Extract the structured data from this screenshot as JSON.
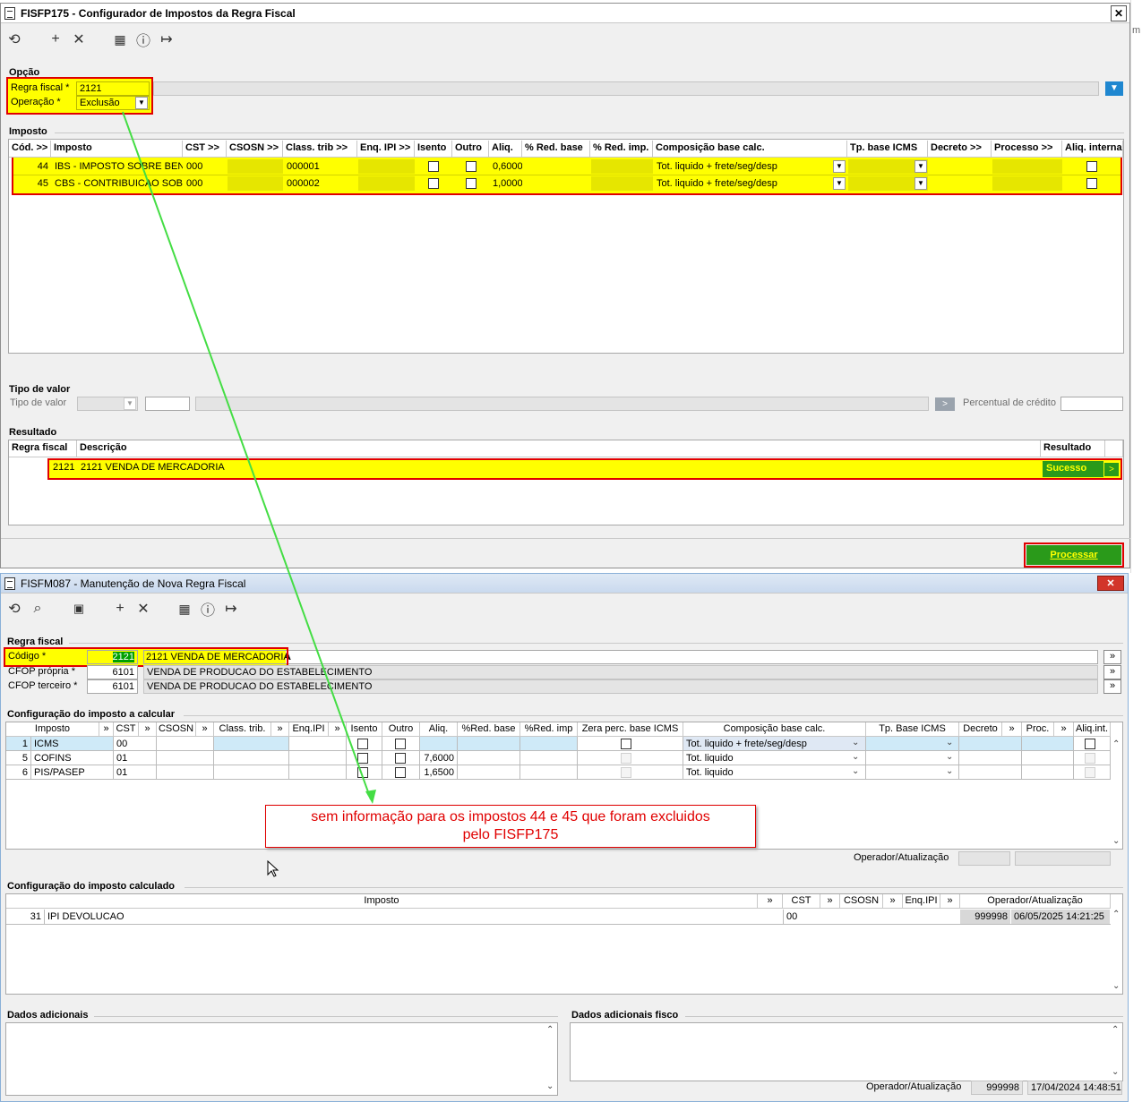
{
  "win1": {
    "title": "FISFP175 - Configurador de Impostos da Regra Fiscal",
    "close": "✕",
    "opcao": {
      "title": "Opção",
      "regra_label": "Regra fiscal *",
      "regra_value": "2121",
      "operacao_label": "Operação *",
      "operacao_value": "Exclusão"
    },
    "imposto": {
      "title": "Imposto",
      "headers": [
        "Cód. >>",
        "Imposto",
        "CST >>",
        "CSOSN >>",
        "Class. trib >>",
        "Enq. IPI >>",
        "Isento",
        "Outro",
        "Aliq.",
        "% Red. base",
        "% Red. imp.",
        "Composição base calc.",
        "Tp. base ICMS",
        "Decreto >>",
        "Processo  >>",
        "Aliq. interna"
      ],
      "rows": [
        {
          "cod": "44",
          "imposto": "IBS - IMPOSTO SOBRE BENS",
          "cst": "000",
          "class": "000001",
          "aliq": "0,6000",
          "comp": "Tot. liquido + frete/seg/desp"
        },
        {
          "cod": "45",
          "imposto": "CBS - CONTRIBUICAO SOBRI",
          "cst": "000",
          "class": "000002",
          "aliq": "1,0000",
          "comp": "Tot. liquido + frete/seg/desp"
        }
      ]
    },
    "tipo": {
      "title": "Tipo de valor",
      "label": "Tipo de valor",
      "perc_label": "Percentual de crédito"
    },
    "resultado": {
      "title": "Resultado",
      "headers": [
        "Regra fiscal",
        "Descrição",
        "Resultado"
      ],
      "row": {
        "regra": "2121",
        "descricao": "2121 VENDA DE MERCADORIA",
        "resultado": "Sucesso",
        "btn": ">"
      }
    },
    "processar": "Processar"
  },
  "win2": {
    "title": "FISFM087 - Manutenção de Nova Regra Fiscal",
    "close": "✕",
    "regra": {
      "title": "Regra fiscal",
      "codigo_label": "Código *",
      "codigo_value": "2121",
      "codigo_desc": "2121 VENDA DE MERCADORIA",
      "cfop_propria_label": "CFOP própria *",
      "cfop_propria_value": "6101",
      "cfop_propria_desc": "VENDA DE PRODUCAO DO ESTABELECIMENTO",
      "cfop_terceiro_label": "CFOP terceiro *",
      "cfop_terceiro_value": "6101",
      "cfop_terceiro_desc": "VENDA DE PRODUCAO DO ESTABELECIMENTO",
      "arrow": "»"
    },
    "calcular": {
      "title": "Configuração do imposto a calcular",
      "headers": [
        "Imposto",
        "»",
        "CST",
        "»",
        "CSOSN",
        "»",
        "Class. trib.",
        "»",
        "Enq.IPI",
        "»",
        "Isento",
        "Outro",
        "Aliq.",
        "%Red. base",
        "%Red. imp",
        "Zera perc. base ICMS",
        "Composição base calc.",
        "Tp. Base ICMS",
        "Decreto",
        "»",
        "Proc.",
        "»",
        "Aliq.int."
      ],
      "rows": [
        {
          "cod": "1",
          "imposto": "ICMS",
          "cst": "00",
          "aliq": "",
          "comp": "Tot. liquido + frete/seg/desp"
        },
        {
          "cod": "5",
          "imposto": "COFINS",
          "cst": "01",
          "aliq": "7,6000",
          "comp": "Tot. liquido"
        },
        {
          "cod": "6",
          "imposto": "PIS/PASEP",
          "cst": "01",
          "aliq": "1,6500",
          "comp": "Tot. liquido"
        }
      ],
      "operador_label": "Operador/Atualização"
    },
    "calculado": {
      "title": "Configuração do imposto calculado",
      "headers": [
        "Imposto",
        "»",
        "CST",
        "»",
        "CSOSN",
        "»",
        "Enq.IPI",
        "»",
        "Operador/Atualização"
      ],
      "row": {
        "cod": "31",
        "imposto": "IPI DEVOLUCAO",
        "cst": "00",
        "operador": "999998",
        "data": "06/05/2025 14:21:25"
      }
    },
    "dados": {
      "title": "Dados adicionais",
      "fisco_title": "Dados adicionais fisco",
      "operador_label": "Operador/Atualização",
      "operador": "999998",
      "data": "17/04/2024 14:48:51"
    }
  },
  "annotation": {
    "line1": "sem informação para os impostos 44 e 45 que foram excluidos",
    "line2": "pelo FISFP175"
  },
  "colors": {
    "highlight": "#ffff00",
    "annotation_red": "#e00000",
    "arrow_green": "#44dd44",
    "success": "#2a9a1a"
  }
}
